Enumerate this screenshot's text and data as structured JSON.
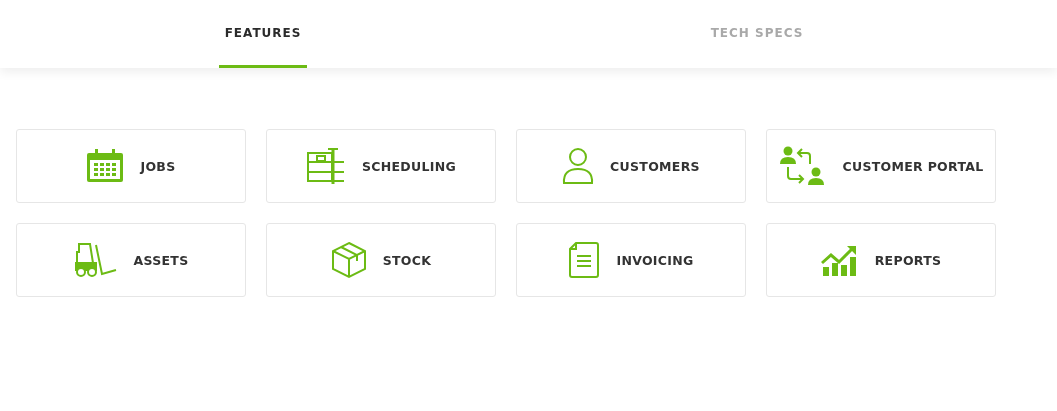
{
  "tabs": [
    {
      "label": "FEATURES",
      "selected": true
    },
    {
      "label": "TECH SPECS",
      "selected": false
    }
  ],
  "features": [
    {
      "label": "JOBS"
    },
    {
      "label": "SCHEDULING"
    },
    {
      "label": "CUSTOMERS"
    },
    {
      "label": "CUSTOMER PORTAL"
    },
    {
      "label": "ASSETS"
    },
    {
      "label": "STOCK"
    },
    {
      "label": "INVOICING"
    },
    {
      "label": "REPORTS"
    }
  ]
}
